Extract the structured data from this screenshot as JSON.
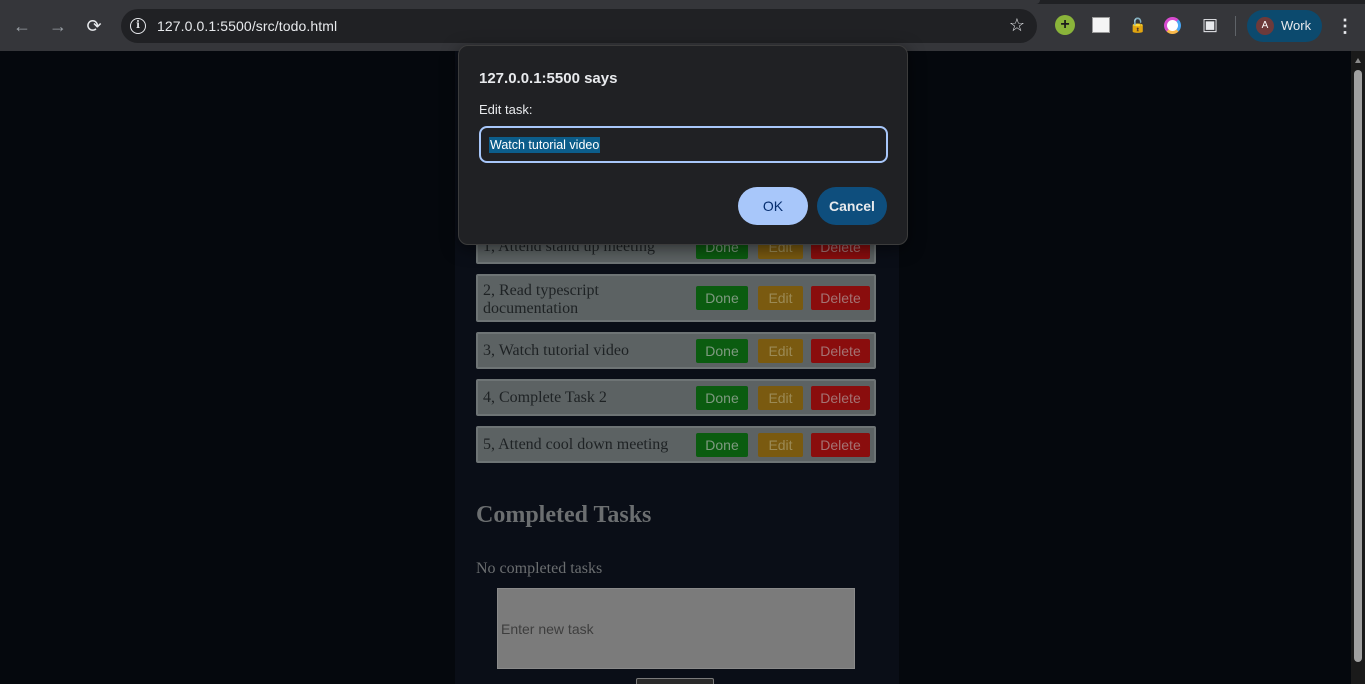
{
  "browser": {
    "url": "127.0.0.1:5500/src/todo.html",
    "profile_initial": "A",
    "profile_name": "Work",
    "icons": {
      "back": "arrow-left-icon",
      "forward": "arrow-right-icon",
      "reload": "reload-icon",
      "site_info": "info-icon",
      "bookmark": "star-icon",
      "extensions": "puzzle-icon",
      "menu": "kebab-menu-icon"
    }
  },
  "dialog": {
    "title": "127.0.0.1:5500 says",
    "message": "Edit task:",
    "input_value": "Watch tutorial video",
    "ok_label": "OK",
    "cancel_label": "Cancel"
  },
  "tasks": [
    {
      "text": "1, Attend stand up meeting",
      "done": "Done",
      "edit": "Edit",
      "delete": "Delete"
    },
    {
      "text": "2, Read typescript documentation",
      "done": "Done",
      "edit": "Edit",
      "delete": "Delete"
    },
    {
      "text": "3, Watch tutorial video",
      "done": "Done",
      "edit": "Edit",
      "delete": "Delete"
    },
    {
      "text": "4, Complete Task 2",
      "done": "Done",
      "edit": "Edit",
      "delete": "Delete"
    },
    {
      "text": "5, Attend cool down meeting",
      "done": "Done",
      "edit": "Edit",
      "delete": "Delete"
    }
  ],
  "completed": {
    "heading": "Completed Tasks",
    "empty_text": "No completed tasks"
  },
  "new_task": {
    "placeholder": "Enter new task"
  },
  "colors": {
    "done": "#0b5c10",
    "edit": "#7a5a10",
    "delete": "#8a0d0d",
    "dialog_ok": "#a8c7fa",
    "dialog_cancel": "#0e4e7d"
  }
}
